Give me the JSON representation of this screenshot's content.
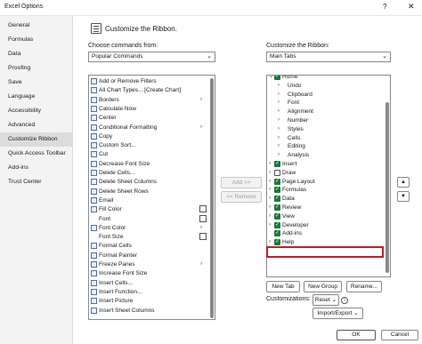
{
  "window": {
    "title": "Excel Options",
    "help": "?",
    "close": "✕"
  },
  "nav": {
    "items": [
      {
        "label": "General"
      },
      {
        "label": "Formulas"
      },
      {
        "label": "Data"
      },
      {
        "label": "Proofing"
      },
      {
        "label": "Save"
      },
      {
        "label": "Language"
      },
      {
        "label": "Accessibility"
      },
      {
        "label": "Advanced"
      },
      {
        "label": "Customize Ribbon",
        "active": true
      },
      {
        "label": "Quick Access Toolbar"
      },
      {
        "label": "Add-ins"
      },
      {
        "label": "Trust Center"
      }
    ]
  },
  "header": {
    "title": "Customize the Ribbon."
  },
  "left": {
    "label": "Choose commands from:",
    "combo_value": "Popular Commands",
    "commands": [
      {
        "label": "Add or Remove Filters",
        "icon": "filter-icon"
      },
      {
        "label": "All Chart Types... [Create Chart]",
        "icon": "chart-icon"
      },
      {
        "label": "Borders",
        "icon": "borders-icon",
        "sub": "arrow"
      },
      {
        "label": "Calculate Now",
        "icon": "calculator-icon"
      },
      {
        "label": "Center",
        "icon": "align-center-icon"
      },
      {
        "label": "Conditional Formatting",
        "icon": "conditional-formatting-icon",
        "sub": "arrow"
      },
      {
        "label": "Copy",
        "icon": "copy-icon"
      },
      {
        "label": "Custom Sort...",
        "icon": "sort-icon"
      },
      {
        "label": "Cut",
        "icon": "scissors-icon"
      },
      {
        "label": "Decrease Font Size",
        "icon": "font-decrease-icon"
      },
      {
        "label": "Delete Cells...",
        "icon": "delete-cells-icon"
      },
      {
        "label": "Delete Sheet Columns",
        "icon": "delete-columns-icon"
      },
      {
        "label": "Delete Sheet Rows",
        "icon": "delete-rows-icon"
      },
      {
        "label": "Email",
        "icon": "email-icon"
      },
      {
        "label": "Fill Color",
        "icon": "fill-color-icon",
        "sub": "box"
      },
      {
        "label": "Font",
        "icon": "none",
        "sub": "box"
      },
      {
        "label": "Font Color",
        "icon": "font-color-icon",
        "sub": "arrow"
      },
      {
        "label": "Font Size",
        "icon": "none",
        "sub": "box"
      },
      {
        "label": "Format Cells",
        "icon": "format-cells-icon"
      },
      {
        "label": "Format Painter",
        "icon": "format-painter-icon"
      },
      {
        "label": "Freeze Panes",
        "icon": "freeze-panes-icon",
        "sub": "arrow"
      },
      {
        "label": "Increase Font Size",
        "icon": "font-increase-icon"
      },
      {
        "label": "Insert Cells...",
        "icon": "insert-cells-icon"
      },
      {
        "label": "Insert Function...",
        "icon": "function-icon"
      },
      {
        "label": "Insert Picture",
        "icon": "picture-icon"
      },
      {
        "label": "Insert Sheet Columns",
        "icon": "insert-columns-icon"
      }
    ]
  },
  "middle": {
    "add": "Add >>",
    "remove": "<< Remove"
  },
  "right": {
    "label": "Customize the Ribbon:",
    "combo_value": "Main Tabs",
    "tree": [
      {
        "label": "Home",
        "level": 0,
        "expanded": true,
        "checked": true
      },
      {
        "label": "Undo",
        "level": 1
      },
      {
        "label": "Clipboard",
        "level": 1
      },
      {
        "label": "Font",
        "level": 1
      },
      {
        "label": "Alignment",
        "level": 1
      },
      {
        "label": "Number",
        "level": 1
      },
      {
        "label": "Styles",
        "level": 1
      },
      {
        "label": "Cells",
        "level": 1
      },
      {
        "label": "Editing",
        "level": 1
      },
      {
        "label": "Analysis",
        "level": 1
      },
      {
        "label": "Insert",
        "level": 0,
        "checked": true
      },
      {
        "label": "Draw",
        "level": 0,
        "checked": false
      },
      {
        "label": "Page Layout",
        "level": 0,
        "checked": true
      },
      {
        "label": "Formulas",
        "level": 0,
        "checked": true
      },
      {
        "label": "Data",
        "level": 0,
        "checked": true
      },
      {
        "label": "Review",
        "level": 0,
        "checked": true
      },
      {
        "label": "View",
        "level": 0,
        "checked": true
      },
      {
        "label": "Developer",
        "level": 0,
        "checked": true,
        "highlighted": true
      },
      {
        "label": "Add-ins",
        "level": 0,
        "checked": true,
        "no_expander": true
      },
      {
        "label": "Help",
        "level": 0,
        "checked": true
      }
    ],
    "new_tab": "New Tab",
    "new_group": "New Group",
    "rename": "Rename...",
    "customizations_label": "Customizations:",
    "reset": "Reset",
    "import_export": "Import/Export",
    "info": "i"
  },
  "footer": {
    "ok": "OK",
    "cancel": "Cancel"
  },
  "colors": {
    "checkbox": "#1b7a3a",
    "highlight": "#c41e2b"
  }
}
